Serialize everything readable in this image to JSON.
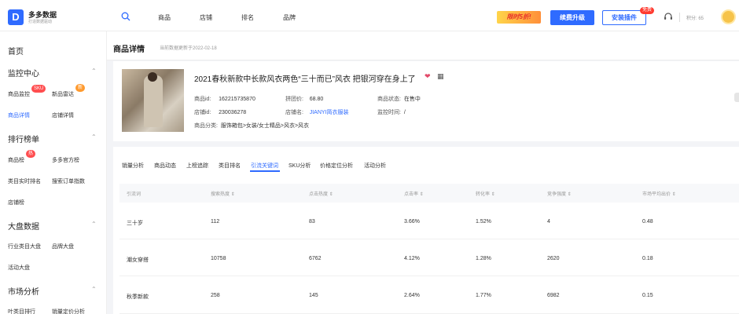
{
  "brand": {
    "name": "多多数据",
    "tagline": "打造数据驱动"
  },
  "nav": [
    {
      "label": "商品"
    },
    {
      "label": "店铺"
    },
    {
      "label": "排名"
    },
    {
      "label": "品牌"
    }
  ],
  "header_actions": {
    "promo": "限时5折!",
    "upgrade": "续费升级",
    "install": "安装插件",
    "free_badge": "免费",
    "points": "积分: 65"
  },
  "sidebar": {
    "home": "首页",
    "groups": [
      {
        "title": "监控中心",
        "items": [
          {
            "label": "商品监控",
            "badge": "SKU"
          },
          {
            "label": "新品雷达",
            "badge": "新"
          },
          {
            "label": "商品详情",
            "active": true
          },
          {
            "label": "店铺详情"
          }
        ]
      },
      {
        "title": "排行榜单",
        "items": [
          {
            "label": "商品榜",
            "badge": "热"
          },
          {
            "label": "多多官方榜"
          },
          {
            "label": "类目实时排名"
          },
          {
            "label": "搜索订单指数"
          },
          {
            "label": "店铺榜"
          }
        ]
      },
      {
        "title": "大盘数据",
        "items": [
          {
            "label": "行业类目大盘"
          },
          {
            "label": "品牌大盘"
          },
          {
            "label": "活动大盘"
          }
        ]
      },
      {
        "title": "市场分析",
        "items": [
          {
            "label": "叶类目排行"
          },
          {
            "label": "销量定价分析"
          }
        ]
      }
    ]
  },
  "page": {
    "title": "商品详情",
    "updated": "当前数据更新于2022-02-18"
  },
  "product": {
    "title": "2021春秋新款中长款风衣两色“三十而已”风衣 把银河穿在身上了",
    "icons": [
      "heart-icon",
      "grid-icon"
    ],
    "fields": {
      "id_label": "商品id:",
      "id_value": "162215735870",
      "group_price_label": "拼团价:",
      "group_price_value": "68.80",
      "status_label": "商品状态:",
      "status_value": "在售中",
      "shop_id_label": "店铺id:",
      "shop_id_value": "230036278",
      "shop_name_label": "店铺名:",
      "shop_name_value": "JIANYI简衣服装",
      "monitor_time_label": "监控时间:",
      "monitor_time_value": "/",
      "category_label": "商品分类:",
      "category_value": "服饰箱包>女装/女士精品>风衣>风衣"
    }
  },
  "tabs": [
    {
      "label": "销量分析"
    },
    {
      "label": "商品动态"
    },
    {
      "label": "上榜追踪"
    },
    {
      "label": "类目排名"
    },
    {
      "label": "引流关键词",
      "active": true
    },
    {
      "label": "SKU分析"
    },
    {
      "label": "价格定位分析"
    },
    {
      "label": "活动分析"
    }
  ],
  "table": {
    "headers": [
      "引流词",
      "搜索热度 ⇕",
      "点击热度 ⇕",
      "点击率 ⇕",
      "转化率 ⇕",
      "竞争强度 ⇕",
      "市场平均出价 ⇕"
    ],
    "rows": [
      [
        "三十岁",
        "112",
        "83",
        "3.66%",
        "1.52%",
        "4",
        "0.48"
      ],
      [
        "潮女穿搭",
        "10758",
        "6762",
        "4.12%",
        "1.28%",
        "2620",
        "0.18"
      ],
      [
        "秋季新款",
        "258",
        "145",
        "2.64%",
        "1.77%",
        "6982",
        "0.15"
      ]
    ]
  },
  "colors": {
    "accent": "#2f6bff",
    "badge_red": "#ff4d4f",
    "badge_orange": "#ff9a2e"
  }
}
